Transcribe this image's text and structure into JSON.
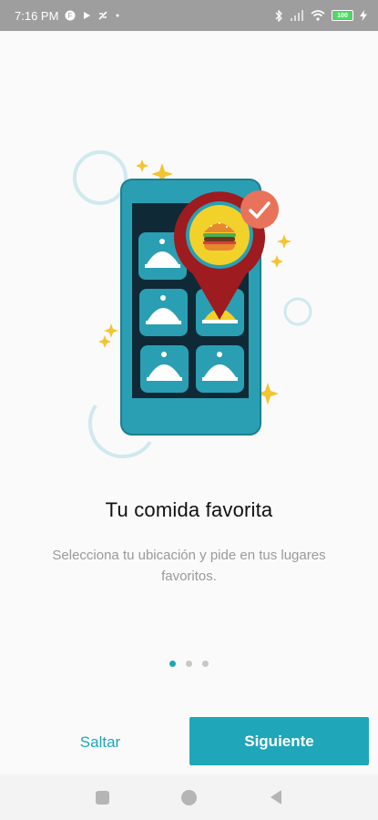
{
  "status_bar": {
    "time": "7:16 PM",
    "battery": "100",
    "icons": [
      "notification-icon",
      "play-icon",
      "sync-icon",
      "dot-icon",
      "bluetooth-icon",
      "signal-icon",
      "wifi-icon",
      "battery-icon",
      "charging-icon"
    ]
  },
  "onboarding": {
    "title": "Tu comida favorita",
    "subtitle": "Selecciona tu ubicación y pide en tus lugares favoritos.",
    "page_index": 1,
    "page_count": 3
  },
  "actions": {
    "skip_label": "Saltar",
    "next_label": "Siguiente"
  },
  "colors": {
    "accent": "#1fa6b9",
    "phone_body": "#2a9fb3",
    "phone_screen": "#0f2a36",
    "pin": "#9e1b1f",
    "burger_bg": "#f2d22a",
    "check_badge": "#e8735a",
    "sparkle": "#f4c430"
  },
  "navigation": {
    "buttons": [
      "recents",
      "home",
      "back"
    ]
  }
}
